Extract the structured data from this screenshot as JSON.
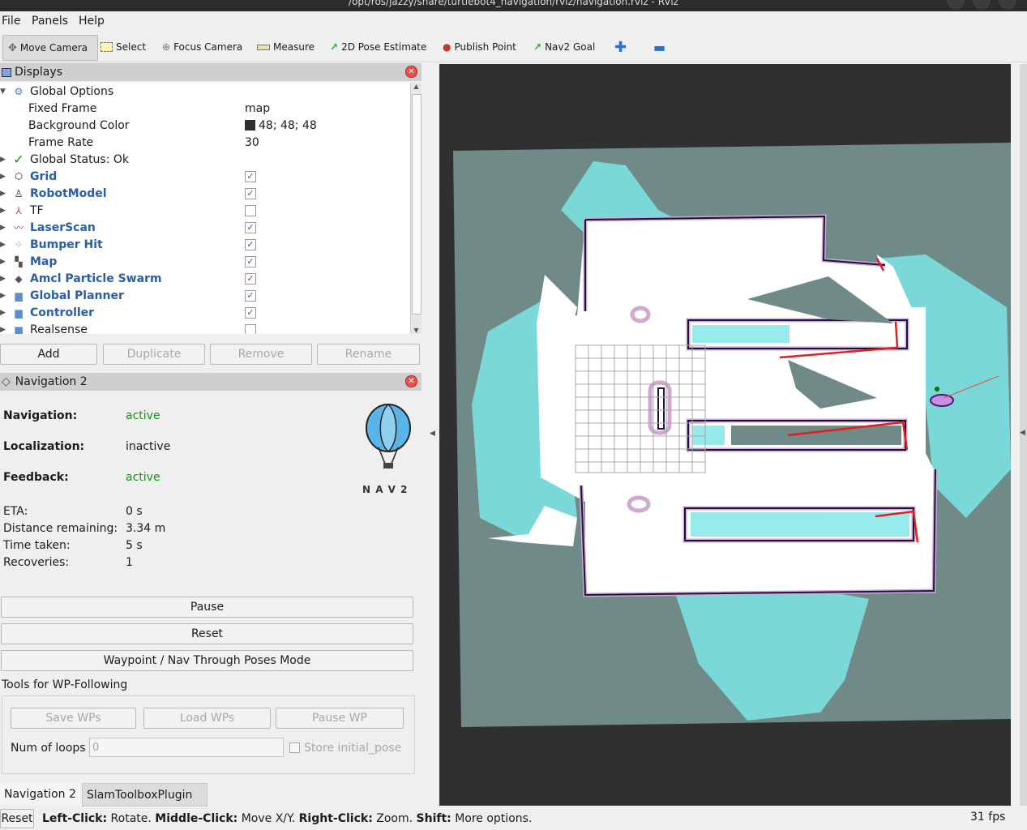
{
  "window": {
    "title": "/opt/ros/jazzy/share/turtlebot4_navigation/rviz/navigation.rviz - RViz"
  },
  "menu": {
    "file": "File",
    "panels": "Panels",
    "help": "Help"
  },
  "toolbar": {
    "move_camera": "Move Camera",
    "select": "Select",
    "focus_camera": "Focus Camera",
    "measure": "Measure",
    "pose_estimate": "2D Pose Estimate",
    "publish_point": "Publish Point",
    "nav2_goal": "Nav2 Goal"
  },
  "displays": {
    "title": "Displays",
    "global_options": "Global Options",
    "fixed_frame_label": "Fixed Frame",
    "fixed_frame_value": "map",
    "background_color_label": "Background Color",
    "background_color_value": "48; 48; 48",
    "background_color_hex": "#303030",
    "frame_rate_label": "Frame Rate",
    "frame_rate_value": "30",
    "global_status": "Global Status: Ok",
    "items": [
      {
        "label": "Grid",
        "checked": true
      },
      {
        "label": "RobotModel",
        "checked": true
      },
      {
        "label": "TF",
        "checked": false
      },
      {
        "label": "LaserScan",
        "checked": true
      },
      {
        "label": "Bumper Hit",
        "checked": true
      },
      {
        "label": "Map",
        "checked": true
      },
      {
        "label": "Amcl Particle Swarm",
        "checked": true
      },
      {
        "label": "Global Planner",
        "checked": true
      },
      {
        "label": "Controller",
        "checked": true
      },
      {
        "label": "Realsense",
        "checked": false
      }
    ],
    "buttons": {
      "add": "Add",
      "duplicate": "Duplicate",
      "remove": "Remove",
      "rename": "Rename"
    }
  },
  "nav2": {
    "title": "Navigation 2",
    "navigation_label": "Navigation:",
    "navigation_value": "active",
    "localization_label": "Localization:",
    "localization_value": "inactive",
    "feedback_label": "Feedback:",
    "feedback_value": "active",
    "eta_label": "ETA:",
    "eta_value": "0 s",
    "distance_label": "Distance remaining:",
    "distance_value": "3.34 m",
    "time_label": "Time taken:",
    "time_value": "5 s",
    "recoveries_label": "Recoveries:",
    "recoveries_value": "1",
    "logo_text": "N A V 2",
    "pause": "Pause",
    "reset": "Reset",
    "mode": "Waypoint / Nav Through Poses Mode",
    "wp_tools_label": "Tools for WP-Following",
    "save_wps": "Save WPs",
    "load_wps": "Load WPs",
    "pause_wp": "Pause WP",
    "num_loops_label": "Num of loops",
    "num_loops_placeholder": "0",
    "store_initial_pose": "Store initial_pose"
  },
  "tabs": {
    "nav2": "Navigation 2",
    "slam": "SlamToolboxPlugin"
  },
  "status": {
    "reset": "Reset",
    "left_click": "Left-Click:",
    "rotate": "Rotate.",
    "middle_click": "Middle-Click:",
    "move": "Move X/Y.",
    "right_click": "Right-Click:",
    "zoom": "Zoom.",
    "shift": "Shift:",
    "more": "More options.",
    "fps": "31 fps"
  },
  "colors": {
    "map_unknown": "#6f8a87",
    "map_free": "#ffffff",
    "costmap": "#d0a8d0",
    "scan": "#7de6e6",
    "path": "#e02020"
  }
}
